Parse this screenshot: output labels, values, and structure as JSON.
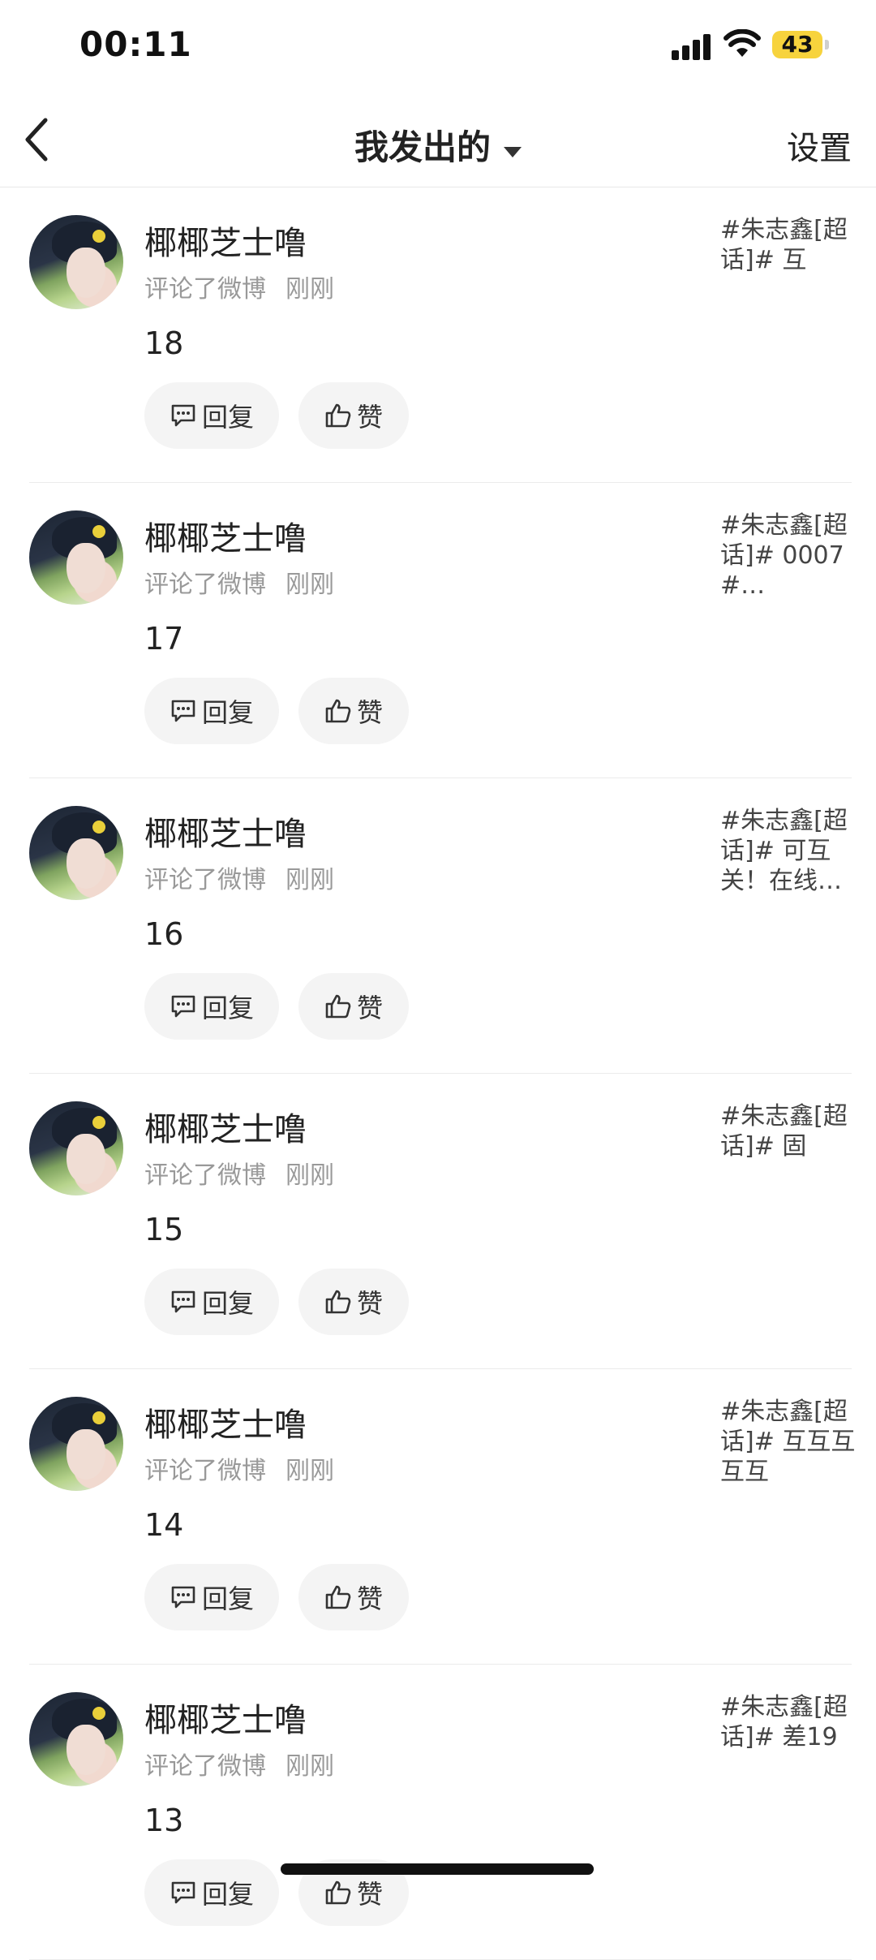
{
  "status_bar": {
    "time": "00:11",
    "battery": "43"
  },
  "nav": {
    "title": "我发出的",
    "settings": "设置"
  },
  "actions": {
    "reply": "回复",
    "like": "赞"
  },
  "items": [
    {
      "name": "椰椰芝士噜",
      "action": "评论了微博",
      "time": "刚刚",
      "content": "18",
      "topic": "#朱志鑫[超话]# 互"
    },
    {
      "name": "椰椰芝士噜",
      "action": "评论了微博",
      "time": "刚刚",
      "content": "17",
      "topic": "#朱志鑫[超话]# 0007#…"
    },
    {
      "name": "椰椰芝士噜",
      "action": "评论了微博",
      "time": "刚刚",
      "content": "16",
      "topic": "#朱志鑫[超话]# 可互关！在线…"
    },
    {
      "name": "椰椰芝士噜",
      "action": "评论了微博",
      "time": "刚刚",
      "content": "15",
      "topic": "#朱志鑫[超话]# 固"
    },
    {
      "name": "椰椰芝士噜",
      "action": "评论了微博",
      "time": "刚刚",
      "content": "14",
      "topic": "#朱志鑫[超话]# 互互互互互"
    },
    {
      "name": "椰椰芝士噜",
      "action": "评论了微博",
      "time": "刚刚",
      "content": "13",
      "topic": "#朱志鑫[超话]# 差19"
    }
  ]
}
